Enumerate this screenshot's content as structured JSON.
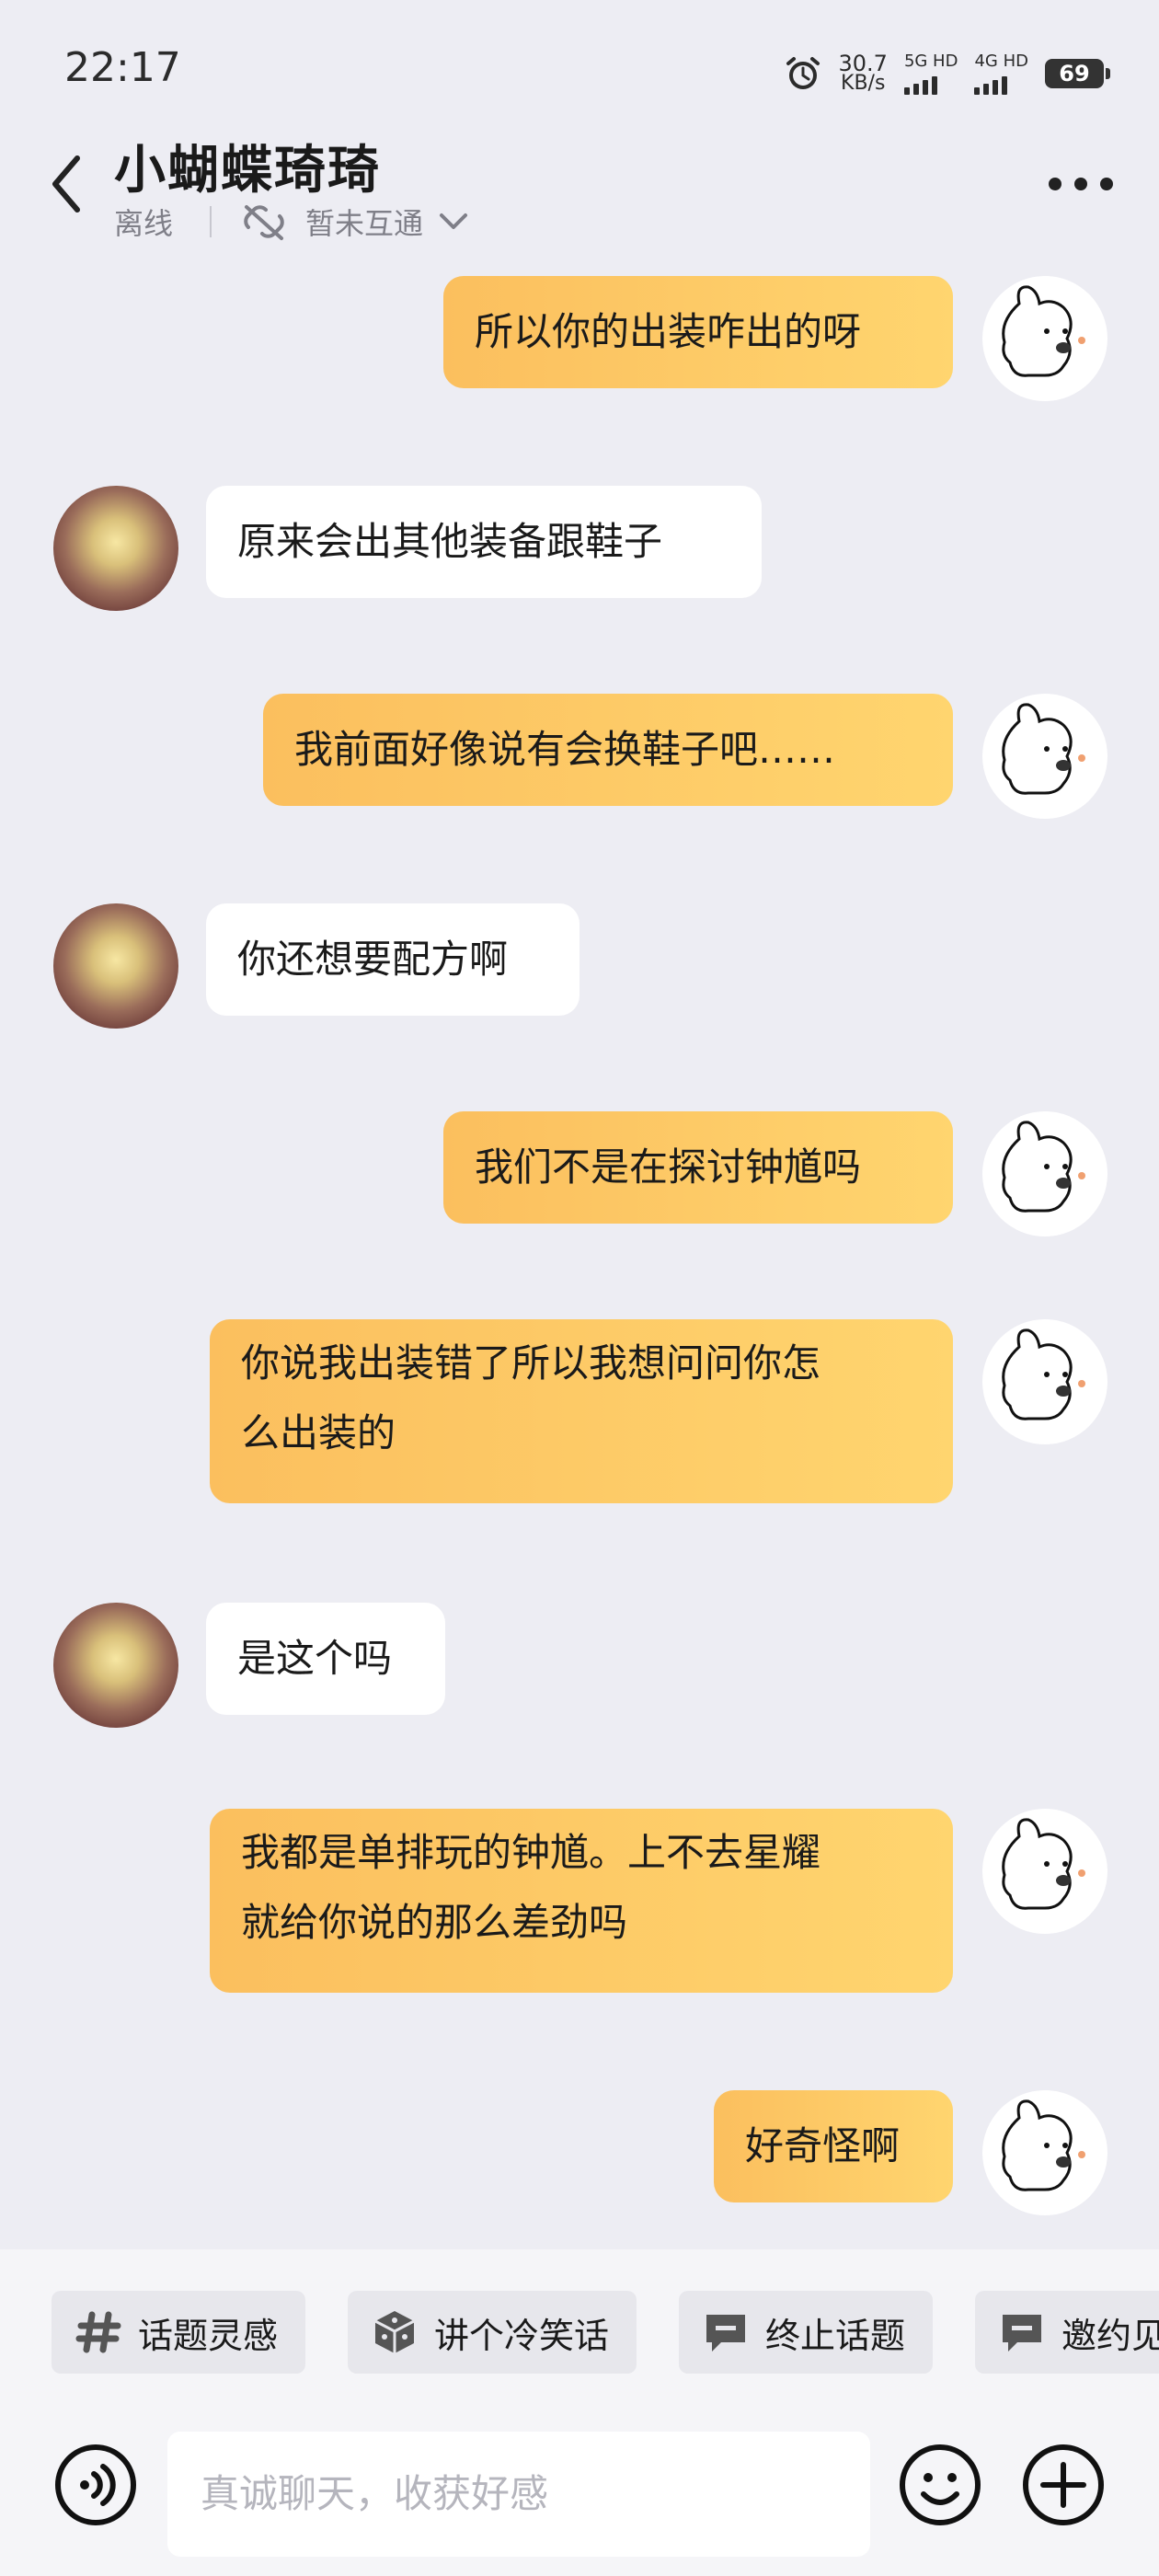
{
  "status_bar": {
    "time": "22:17",
    "net_speed": "30.7",
    "net_unit": "KB/s",
    "sim1": "5G HD",
    "sim2": "4G HD",
    "battery": "69"
  },
  "header": {
    "contact_name": "小蝴蝶琦琦",
    "presence": "离线",
    "relation": "暂未互通"
  },
  "messages": [
    {
      "from": "me",
      "text": "所以你的出装咋出的呀"
    },
    {
      "from": "them",
      "text": "原来会出其他装备跟鞋子"
    },
    {
      "from": "me",
      "text": "我前面好像说有会换鞋子吧……"
    },
    {
      "from": "them",
      "text": "你还想要配方啊"
    },
    {
      "from": "me",
      "text": "我们不是在探讨钟馗吗"
    },
    {
      "from": "me",
      "line1": "你说我出装错了所以我想问问你怎",
      "line2": "么出装的"
    },
    {
      "from": "them",
      "text": "是这个吗"
    },
    {
      "from": "me",
      "line1": "我都是单排玩的钟馗。上不去星耀",
      "line2": "就给你说的那么差劲吗"
    },
    {
      "from": "me",
      "text": "好奇怪啊"
    }
  ],
  "chips": [
    "话题灵感",
    "讲个冷笑话",
    "终止话题",
    "邀约见"
  ],
  "input": {
    "placeholder": "真诚聊天，收获好感"
  },
  "colors": {
    "background": "#ededf3",
    "my_bubble_start": "#fbbf5e",
    "my_bubble_end": "#ffd56f",
    "their_bubble": "#ffffff"
  }
}
